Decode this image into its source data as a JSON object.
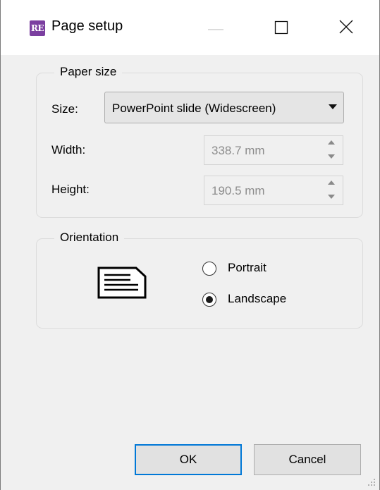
{
  "window": {
    "title": "Page setup",
    "app_icon_text": "RE",
    "app_icon_color": "#7b3fa0",
    "controls": [
      "minimize-icon",
      "maximize-icon",
      "close-icon"
    ]
  },
  "paper_size": {
    "group_label": "Paper size",
    "size_label": "Size:",
    "size_value": "PowerPoint slide (Widescreen)",
    "width_label": "Width:",
    "width_value": "338.7 mm",
    "height_label": "Height:",
    "height_value": "190.5 mm"
  },
  "orientation": {
    "group_label": "Orientation",
    "options": [
      {
        "label": "Portrait",
        "selected": false
      },
      {
        "label": "Landscape",
        "selected": true
      }
    ],
    "preview_icon": "landscape-page-icon"
  },
  "buttons": {
    "ok": "OK",
    "cancel": "Cancel"
  },
  "colors": {
    "accent": "#0078d7",
    "dialog_bg": "#f0f0f0"
  }
}
